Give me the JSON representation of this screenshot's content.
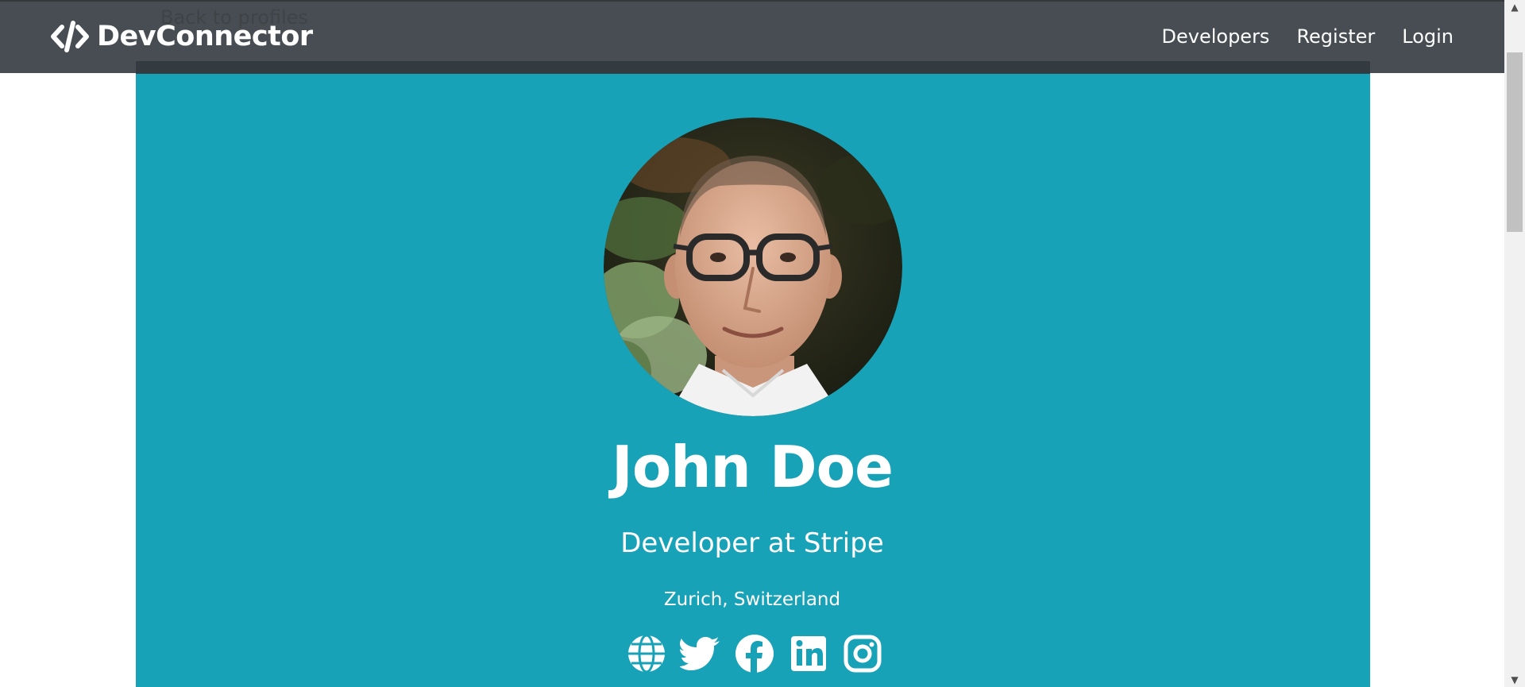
{
  "back_link": "Back to profiles",
  "navbar": {
    "brand": "DevConnector",
    "links": [
      "Developers",
      "Register",
      "Login"
    ]
  },
  "profile": {
    "name": "John Doe",
    "title": "Developer at Stripe",
    "location": "Zurich, Switzerland",
    "socials": [
      "globe-icon",
      "twitter-icon",
      "facebook-icon",
      "linkedin-icon",
      "instagram-icon"
    ]
  },
  "colors": {
    "navbar": "#343a40",
    "primary": "#17a2b8",
    "white": "#ffffff"
  }
}
